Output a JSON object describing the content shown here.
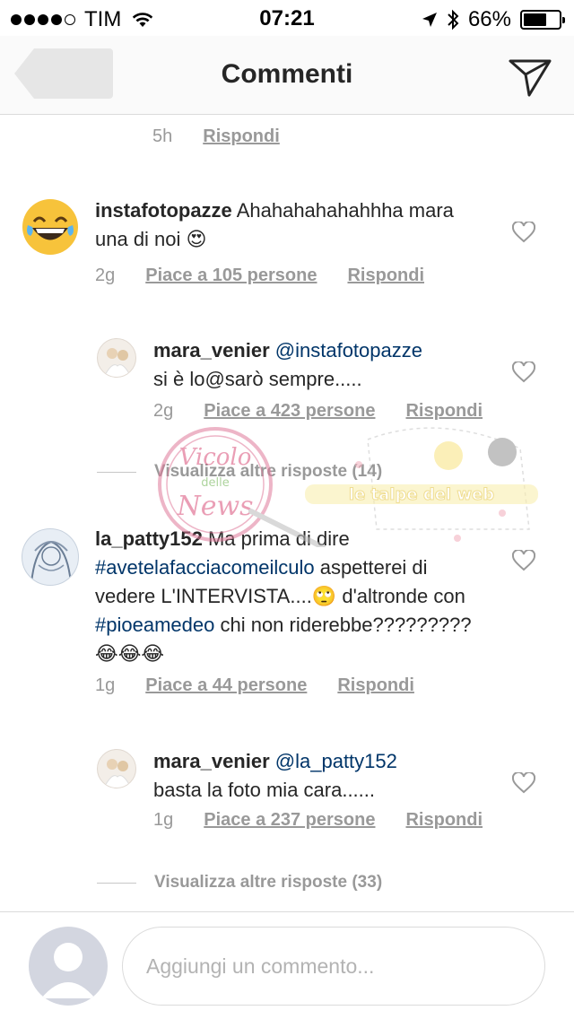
{
  "status_bar": {
    "carrier": "TIM",
    "time": "07:21",
    "battery": "66%",
    "battery_level": 0.66,
    "icons": [
      "signal-dots-icon",
      "wifi-icon",
      "location-arrow-icon",
      "bluetooth-icon",
      "battery-icon"
    ]
  },
  "nav": {
    "title": "Commenti",
    "back_icon": "back-arrow-icon",
    "send_icon": "send-paper-plane-icon"
  },
  "top_meta": {
    "time": "5h",
    "reply": "Rispondi"
  },
  "comments": [
    {
      "username": "instafotopazze",
      "text": "Ahahahahahahhha mara una di noi",
      "emoji": "😍",
      "avatar": "laughing-emoji-avatar",
      "time": "2g",
      "likes": "Piace a 105 persone",
      "reply": "Rispondi"
    },
    {
      "username": "mara_venier",
      "mention": "@instafotopazze",
      "text": "si è lo@sarò sempre.....",
      "time": "2g",
      "likes": "Piace a 423 persone",
      "reply": "Rispondi"
    },
    {
      "username": "la_patty152",
      "text_1": "Ma prima di dire",
      "hashtag_1": "#avetelafacciacomeilculo",
      "text_2": "aspetterei di vedere L'INTERVISTA....",
      "emoji_1": "🙄",
      "text_3": "d'altronde con",
      "hashtag_2": "#pioeamedeo",
      "text_4": "chi non riderebbe?????????",
      "emoji_2": "😂😂😂",
      "time": "1g",
      "likes": "Piace a 44 persone",
      "reply": "Rispondi"
    },
    {
      "username": "mara_venier",
      "mention": "@la_patty152",
      "text": "basta la foto mia cara......",
      "time": "1g",
      "likes": "Piace a 237 persone",
      "reply": "Rispondi"
    }
  ],
  "more_replies_1": "Visualizza altre risposte (14)",
  "more_replies_2": "Visualizza altre risposte (33)",
  "watermark": {
    "stamp_line_1": "Vicolo",
    "stamp_line_2": "delle",
    "stamp_line_3": "News",
    "banner": "le talpe del web"
  },
  "input": {
    "placeholder": "Aggiungi un commento..."
  },
  "colors": {
    "mention": "#003569",
    "meta": "#999999",
    "text": "#262626",
    "border": "#dbdbdb"
  }
}
